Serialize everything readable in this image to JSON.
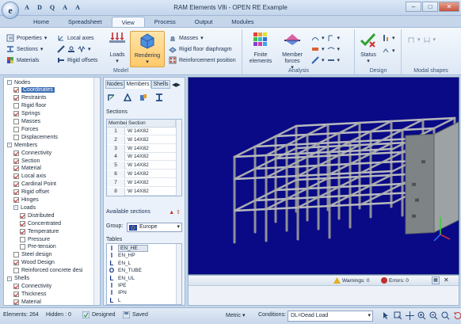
{
  "window": {
    "title": "RAM Elements V8i - OPEN RE Example",
    "orb_letter": "e",
    "quick_access": [
      "A",
      "D",
      "Q",
      "A",
      "A"
    ]
  },
  "tabs": [
    {
      "label": "Home"
    },
    {
      "label": "Spreadsheet"
    },
    {
      "label": "View",
      "active": true
    },
    {
      "label": "Process"
    },
    {
      "label": "Output"
    },
    {
      "label": "Modules"
    }
  ],
  "ribbon": {
    "model": {
      "label": "Model",
      "properties": "Properties",
      "sections": "Sections",
      "materials": "Materials",
      "local_axes": "Local axes",
      "rigid_offsets": "Rigid offsets",
      "loads": "Loads",
      "rendering": "Rendering",
      "masses": "Masses",
      "rigid_floor_diaphragm": "Rigid floor diaphragm",
      "reinforcement_position": "Reinforcement position"
    },
    "analysis": {
      "label": "Analysis",
      "finite_elements": "Finite elements",
      "member_forces": "Member forces"
    },
    "design": {
      "label": "Design",
      "status": "Status"
    },
    "modal": {
      "label": "Modal shapes"
    }
  },
  "tree": [
    {
      "label": "Nodes",
      "level": 0,
      "type": "group"
    },
    {
      "label": "Coordinates",
      "level": 1,
      "checked": true,
      "selected": true
    },
    {
      "label": "Restraints",
      "level": 1,
      "checked": true
    },
    {
      "label": "Rigid floor",
      "level": 1,
      "checked": false
    },
    {
      "label": "Springs",
      "level": 1,
      "checked": true
    },
    {
      "label": "Masses",
      "level": 1,
      "checked": false
    },
    {
      "label": "Forces",
      "level": 1,
      "checked": false
    },
    {
      "label": "Displacements",
      "level": 1,
      "checked": false
    },
    {
      "label": "Members",
      "level": 0,
      "type": "group"
    },
    {
      "label": "Connectivity",
      "level": 1,
      "checked": true
    },
    {
      "label": "Section",
      "level": 1,
      "checked": true
    },
    {
      "label": "Material",
      "level": 1,
      "checked": true
    },
    {
      "label": "Local axis",
      "level": 1,
      "checked": true
    },
    {
      "label": "Cardinal Point",
      "level": 1,
      "checked": true
    },
    {
      "label": "Rigid offset",
      "level": 1,
      "checked": true
    },
    {
      "label": "Hinges",
      "level": 1,
      "checked": true
    },
    {
      "label": "Loads",
      "level": 1,
      "type": "group"
    },
    {
      "label": "Distributed",
      "level": 2,
      "checked": true
    },
    {
      "label": "Concentrated",
      "level": 2,
      "checked": true
    },
    {
      "label": "Temperature",
      "level": 2,
      "checked": true
    },
    {
      "label": "Pressure",
      "level": 2,
      "checked": false
    },
    {
      "label": "Pre-tension",
      "level": 2,
      "checked": false
    },
    {
      "label": "Steel design",
      "level": 1,
      "checked": false
    },
    {
      "label": "Wood Design",
      "level": 1,
      "checked": true
    },
    {
      "label": "Reinforced concrete desi",
      "level": 1,
      "checked": false
    },
    {
      "label": "Shells",
      "level": 0,
      "type": "group"
    },
    {
      "label": "Connectivity",
      "level": 1,
      "checked": true
    },
    {
      "label": "Thickness",
      "level": 1,
      "checked": true
    },
    {
      "label": "Material",
      "level": 1,
      "checked": true
    }
  ],
  "middle_panel": {
    "tabs": [
      {
        "label": "Nodes"
      },
      {
        "label": "Members",
        "active": true
      },
      {
        "label": "Shells"
      }
    ],
    "sections_title": "Sections",
    "columns": [
      "Member",
      "Section"
    ],
    "rows": [
      {
        "member": "1",
        "section": "W 14X82"
      },
      {
        "member": "2",
        "section": "W 14X82"
      },
      {
        "member": "3",
        "section": "W 14X82"
      },
      {
        "member": "4",
        "section": "W 14X82"
      },
      {
        "member": "5",
        "section": "W 14X82"
      },
      {
        "member": "6",
        "section": "W 14X82"
      },
      {
        "member": "7",
        "section": "W 14X82"
      },
      {
        "member": "8",
        "section": "W 14X82"
      }
    ],
    "available_sections": "Available sections",
    "group_label": "Group:",
    "group_value": "Europe",
    "tables_title": "Tables",
    "tables": [
      {
        "shape": "I",
        "label": "EN_HE",
        "selected": true
      },
      {
        "shape": "I",
        "label": "EN_HP"
      },
      {
        "shape": "L",
        "label": "EN_L"
      },
      {
        "shape": "O",
        "label": "EN_TUBE"
      },
      {
        "shape": "L",
        "label": "EN_UL"
      },
      {
        "shape": "I",
        "label": "IPE"
      },
      {
        "shape": "I",
        "label": "IPN"
      },
      {
        "shape": "L",
        "label": "L"
      }
    ]
  },
  "output_pane": {
    "warnings": "Warnings: 0",
    "errors": "Errors: 0"
  },
  "statusbar": {
    "elements": "Elements: 264",
    "hidden": "Hidden : 0",
    "designed": "Designed",
    "saved": "Saved",
    "units": "Metric",
    "conditions_label": "Conditions:",
    "condition": "DL=Dead Load"
  },
  "colors": {
    "viewport_bg": "#0a0a86",
    "selection": "#3d6fb6",
    "ribbon_active": "#ffc96a"
  }
}
